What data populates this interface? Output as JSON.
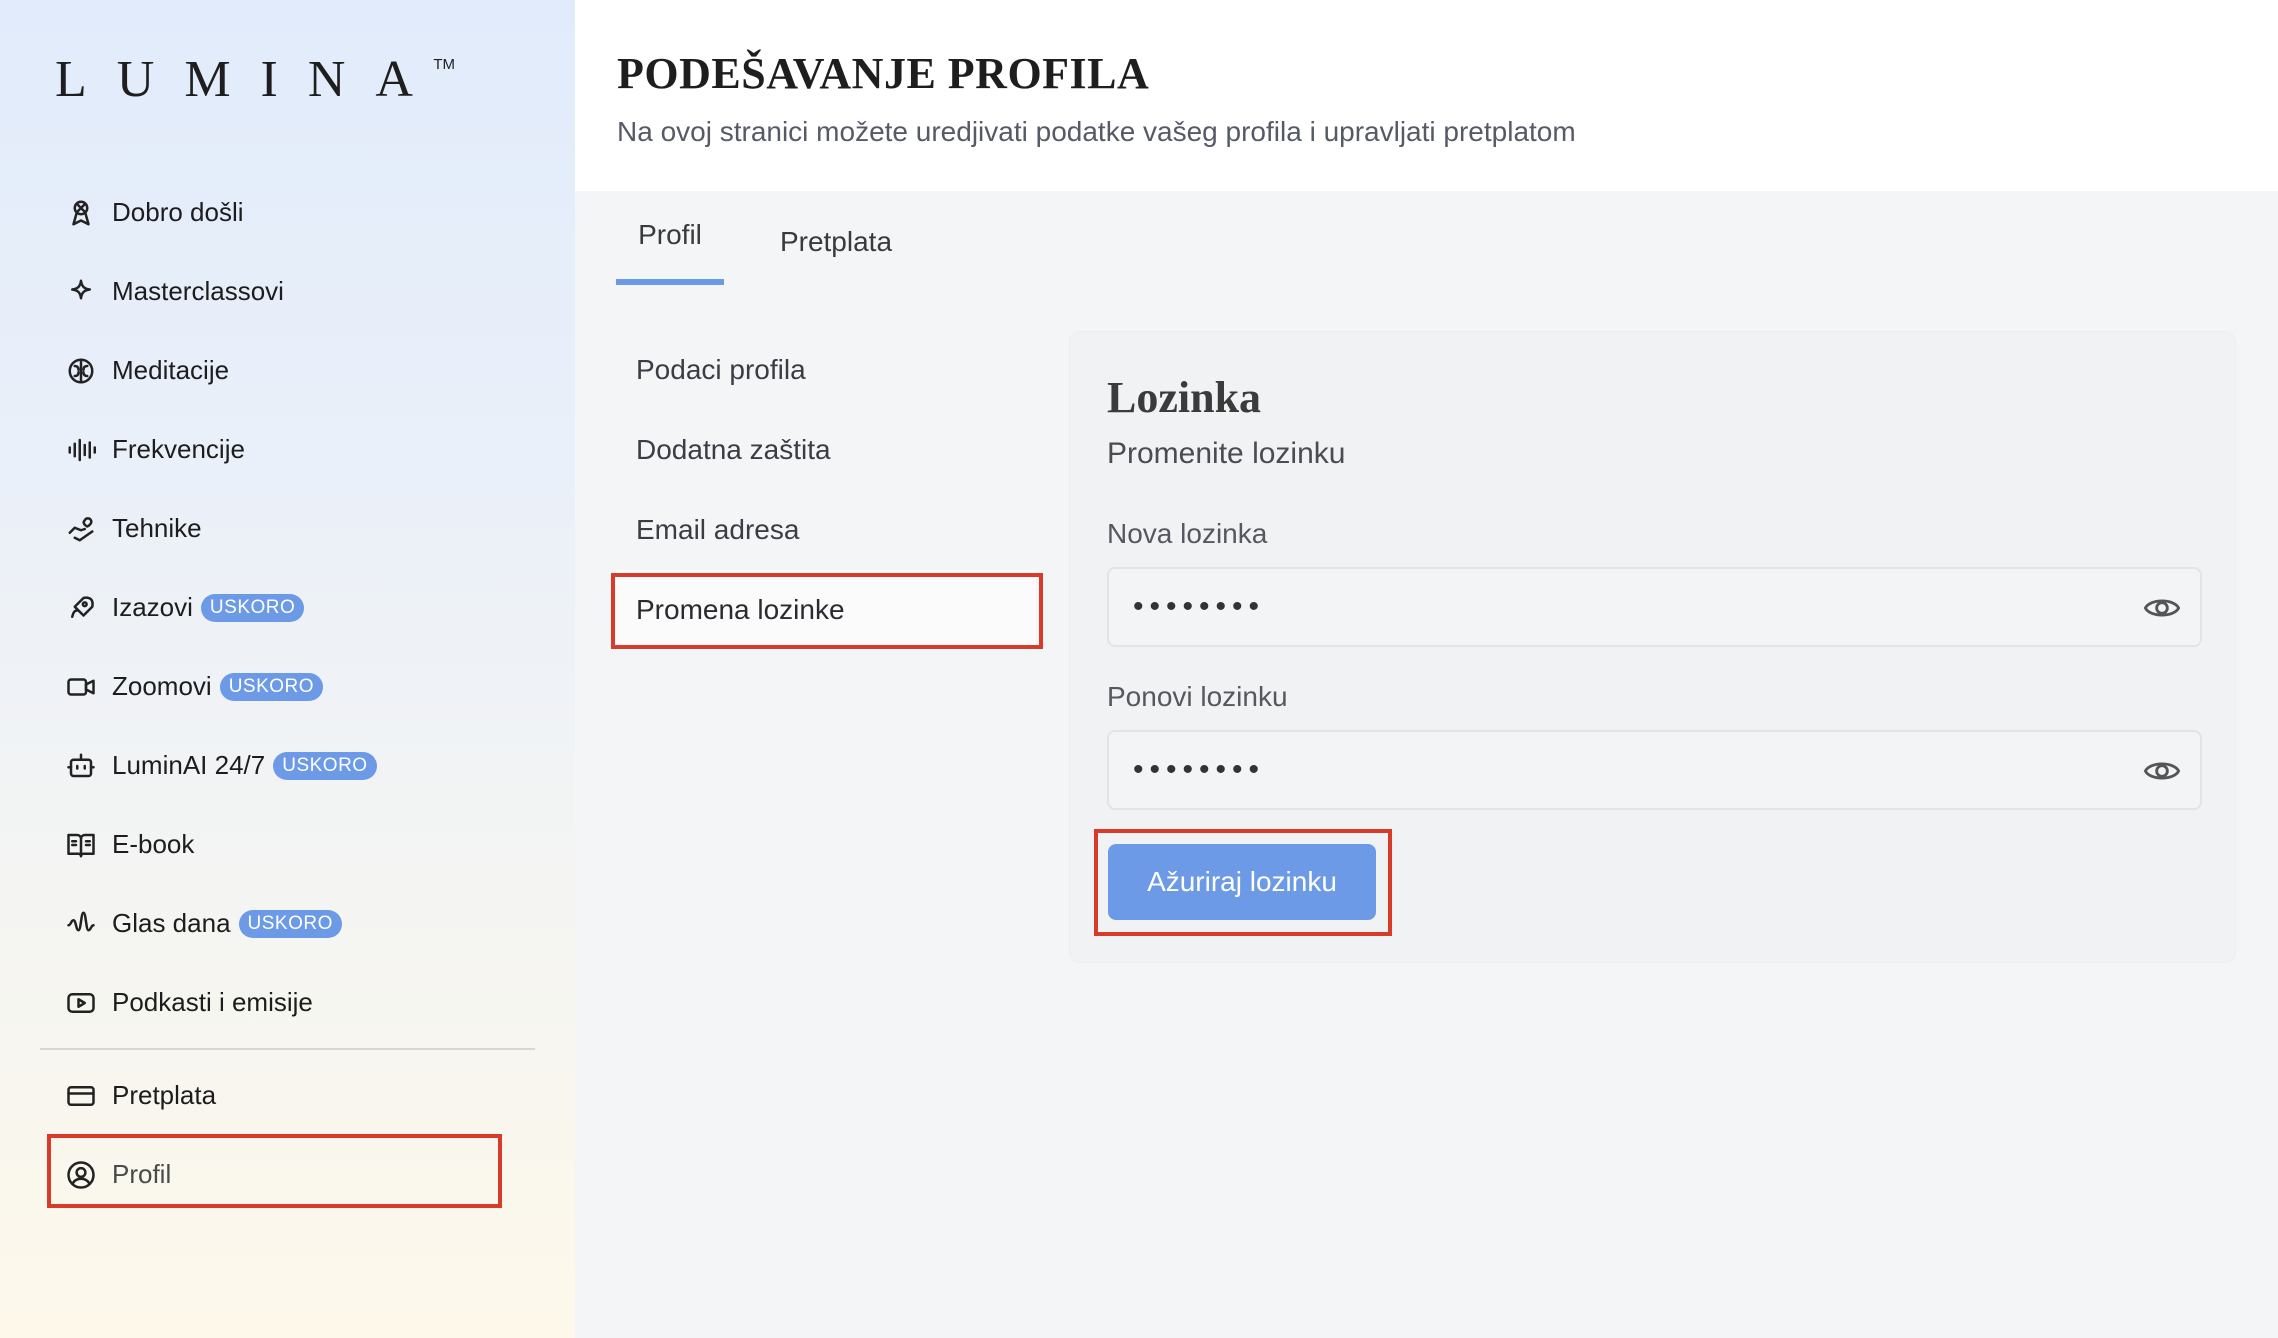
{
  "brand": {
    "logo_text": "LUMINA",
    "trademark": "TM"
  },
  "sidebar": {
    "items": [
      {
        "label": "Dobro došli",
        "icon": "ribbon-icon",
        "badge": ""
      },
      {
        "label": "Masterclassovi",
        "icon": "sparkle-icon",
        "badge": ""
      },
      {
        "label": "Meditacije",
        "icon": "brain-icon",
        "badge": ""
      },
      {
        "label": "Frekvencije",
        "icon": "audio-lines-icon",
        "badge": ""
      },
      {
        "label": "Tehnike",
        "icon": "hand-heart-icon",
        "badge": ""
      },
      {
        "label": "Izazovi",
        "icon": "rocket-icon",
        "badge": "USKORO"
      },
      {
        "label": "Zoomovi",
        "icon": "video-icon",
        "badge": "USKORO"
      },
      {
        "label": "LuminAI 24/7",
        "icon": "bot-icon",
        "badge": "USKORO"
      },
      {
        "label": "E-book",
        "icon": "book-open-icon",
        "badge": ""
      },
      {
        "label": "Glas dana",
        "icon": "audio-wave-icon",
        "badge": "USKORO"
      },
      {
        "label": "Podkasti i emisije",
        "icon": "play-square-icon",
        "badge": ""
      }
    ],
    "account_items": [
      {
        "label": "Pretplata",
        "icon": "credit-card-icon"
      },
      {
        "label": "Profil",
        "icon": "user-circle-icon"
      }
    ],
    "active": "Profil"
  },
  "header": {
    "title": "PODEŠAVANJE PROFILA",
    "subtitle": "Na ovoj stranici možete uredjivati podatke vašeg profila i upravljati pretplatom"
  },
  "tabs": [
    {
      "label": "Profil",
      "active": true
    },
    {
      "label": "Pretplata",
      "active": false
    }
  ],
  "subnav": [
    {
      "label": "Podaci profila",
      "active": false
    },
    {
      "label": "Dodatna zaštita",
      "active": false
    },
    {
      "label": "Email adresa",
      "active": false
    },
    {
      "label": "Promena lozinke",
      "active": true
    }
  ],
  "password_panel": {
    "title": "Lozinka",
    "subtitle": "Promenite lozinku",
    "new_password": {
      "label": "Nova lozinka",
      "value": "••••••••"
    },
    "repeat_password": {
      "label": "Ponovi lozinku",
      "value": "••••••••"
    },
    "submit_label": "Ažuriraj lozinku"
  },
  "colors": {
    "accent": "#6c9ae6",
    "highlight_box": "#d93b2b",
    "sidebar_top": "#e1ebfb",
    "sidebar_bottom": "#fdf8ea"
  }
}
